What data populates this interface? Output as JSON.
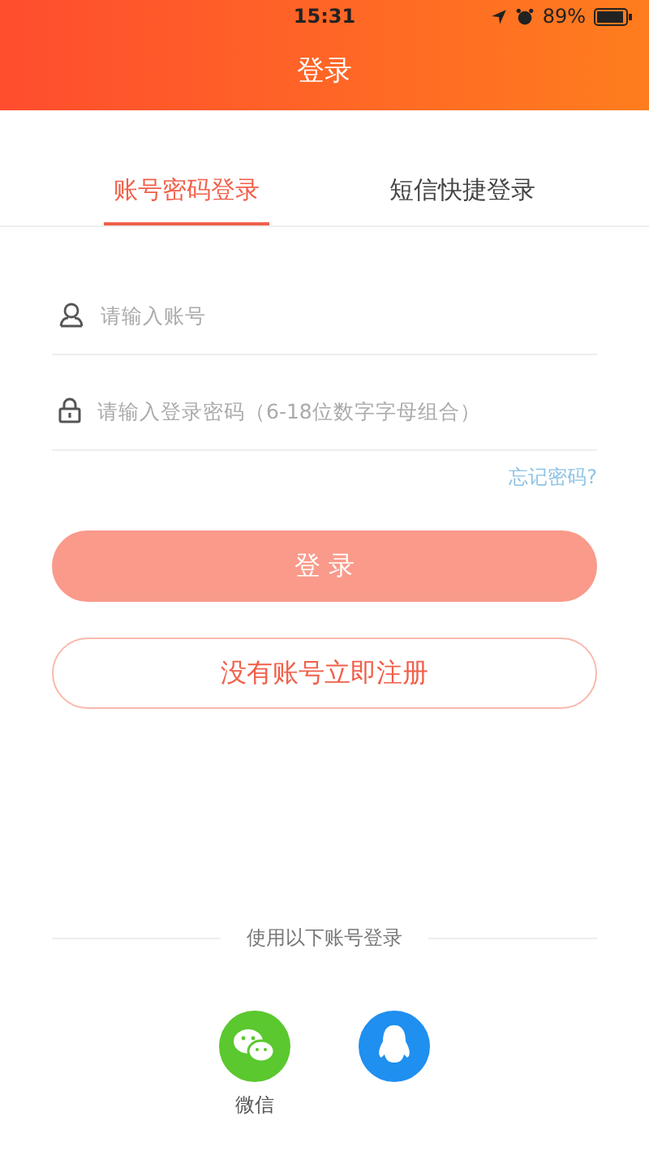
{
  "status_bar": {
    "time": "15:31",
    "battery": "89%"
  },
  "header": {
    "title": "登录"
  },
  "tabs": [
    {
      "label": "账号密码登录",
      "selected": true
    },
    {
      "label": "短信快捷登录",
      "selected": false
    }
  ],
  "fields": [
    {
      "kind": "account",
      "placeholder": "请输入账号"
    },
    {
      "kind": "password",
      "placeholder": "请输入登录密码（6-18位数字字母组合）"
    }
  ],
  "forgot_link": "忘记密码?",
  "login_button": {
    "label": "登 录",
    "disabled": true
  },
  "register_button": "没有账号立即注册",
  "social": {
    "title": "使用以下账号登录",
    "items": [
      {
        "kind": "wechat",
        "label": "微信"
      },
      {
        "kind": "qq"
      }
    ]
  }
}
